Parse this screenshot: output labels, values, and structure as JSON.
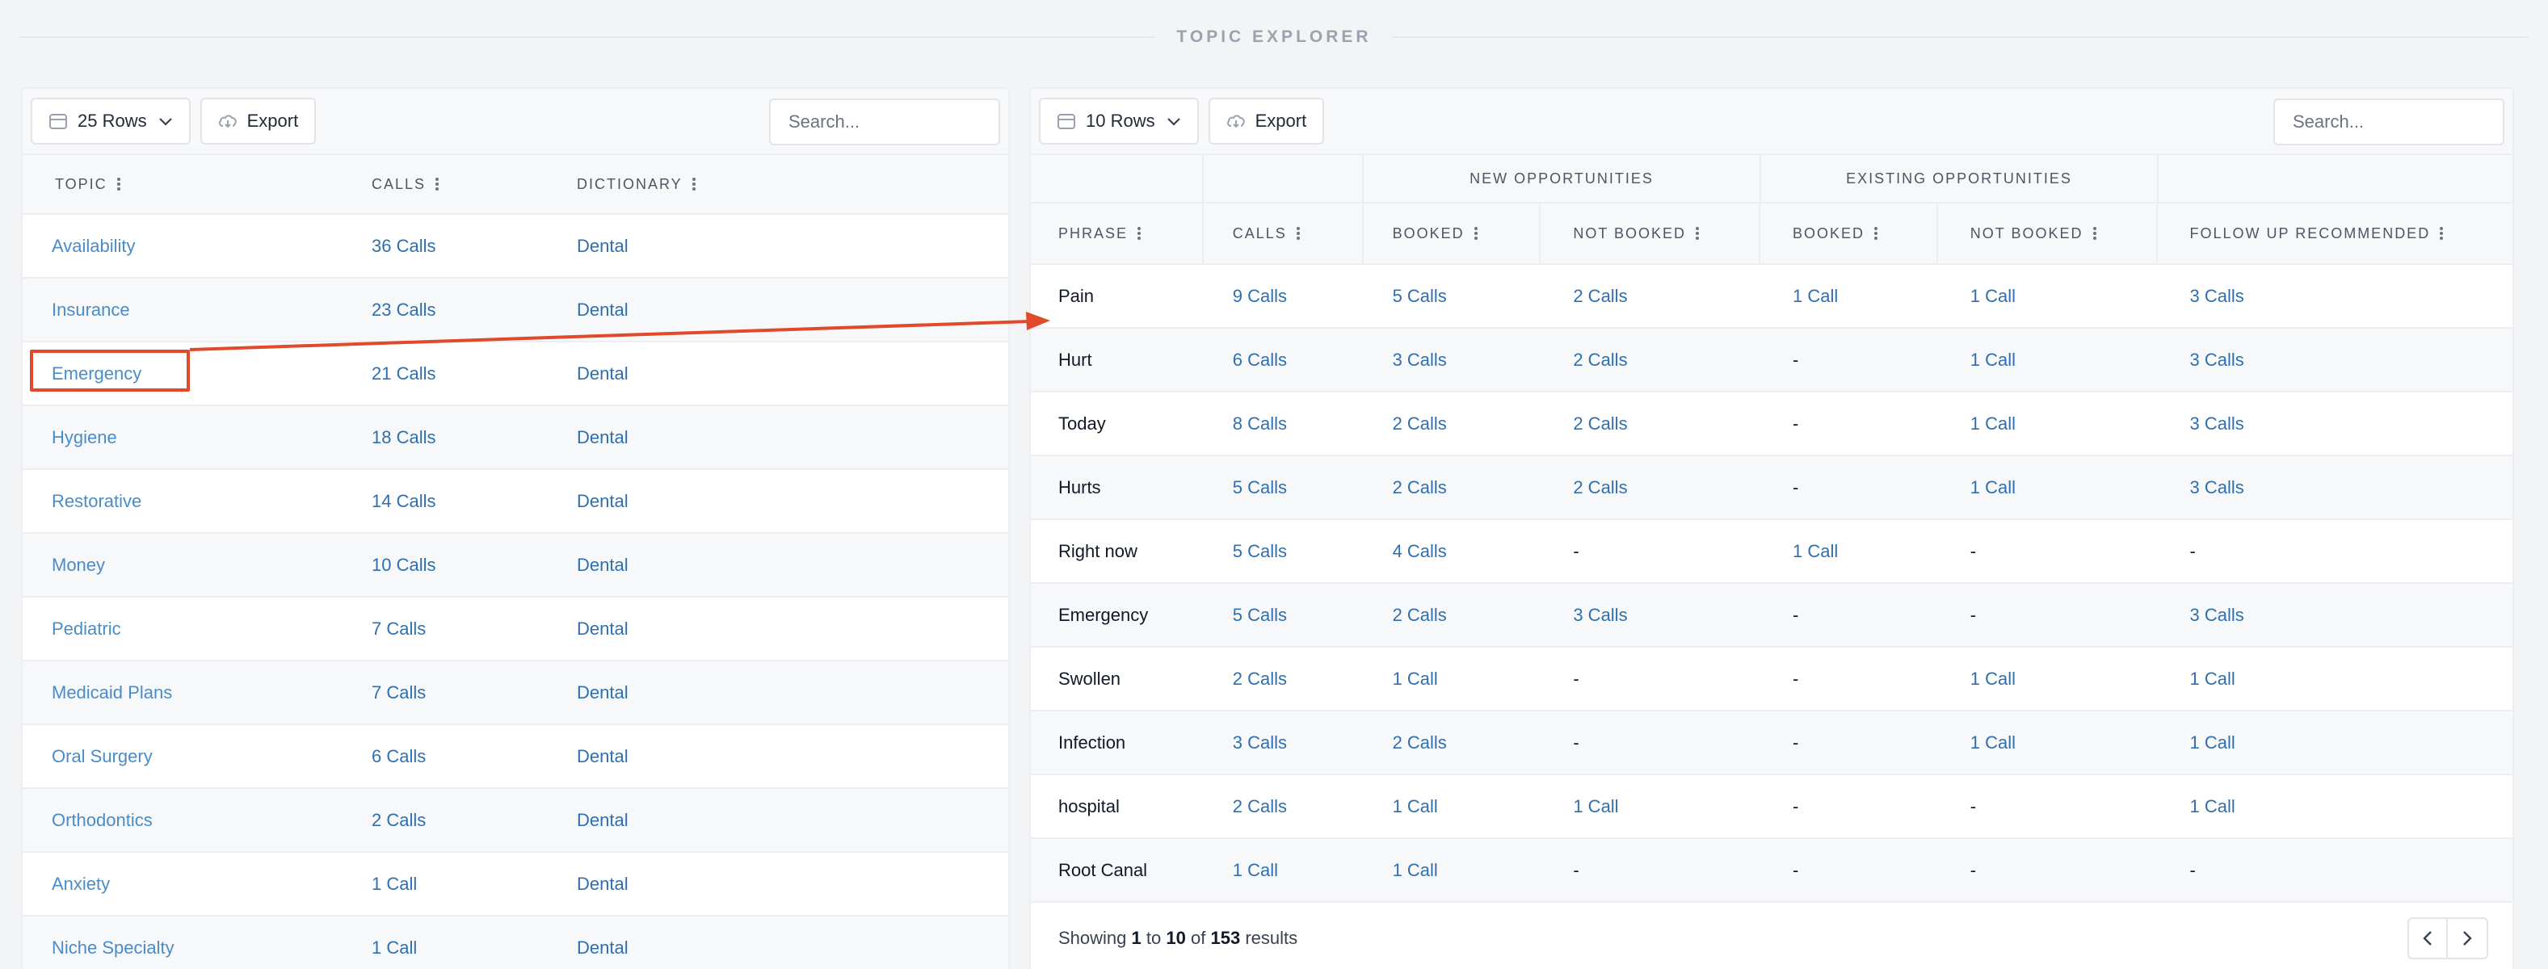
{
  "section_title": "TOPIC EXPLORER",
  "left": {
    "rows_label": "25 Rows",
    "export_label": "Export",
    "search_placeholder": "Search...",
    "columns": [
      "TOPIC",
      "CALLS",
      "DICTIONARY"
    ],
    "rows": [
      {
        "topic": "Availability",
        "calls": "36 Calls",
        "dictionary": "Dental"
      },
      {
        "topic": "Insurance",
        "calls": "23 Calls",
        "dictionary": "Dental"
      },
      {
        "topic": "Emergency",
        "calls": "21 Calls",
        "dictionary": "Dental"
      },
      {
        "topic": "Hygiene",
        "calls": "18 Calls",
        "dictionary": "Dental"
      },
      {
        "topic": "Restorative",
        "calls": "14 Calls",
        "dictionary": "Dental"
      },
      {
        "topic": "Money",
        "calls": "10 Calls",
        "dictionary": "Dental"
      },
      {
        "topic": "Pediatric",
        "calls": "7 Calls",
        "dictionary": "Dental"
      },
      {
        "topic": "Medicaid Plans",
        "calls": "7 Calls",
        "dictionary": "Dental"
      },
      {
        "topic": "Oral Surgery",
        "calls": "6 Calls",
        "dictionary": "Dental"
      },
      {
        "topic": "Orthodontics",
        "calls": "2 Calls",
        "dictionary": "Dental"
      },
      {
        "topic": "Anxiety",
        "calls": "1 Call",
        "dictionary": "Dental"
      },
      {
        "topic": "Niche Specialty",
        "calls": "1 Call",
        "dictionary": "Dental"
      }
    ]
  },
  "right": {
    "rows_label": "10 Rows",
    "export_label": "Export",
    "search_placeholder": "Search...",
    "groups": [
      "NEW OPPORTUNITIES",
      "EXISTING OPPORTUNITIES"
    ],
    "columns": [
      "PHRASE",
      "CALLS",
      "BOOKED",
      "NOT BOOKED",
      "BOOKED",
      "NOT BOOKED",
      "FOLLOW UP RECOMMENDED"
    ],
    "rows": [
      [
        "Pain",
        "9 Calls",
        "5 Calls",
        "2 Calls",
        "1 Call",
        "1 Call",
        "3 Calls"
      ],
      [
        "Hurt",
        "6 Calls",
        "3 Calls",
        "2 Calls",
        "-",
        "1 Call",
        "3 Calls"
      ],
      [
        "Today",
        "8 Calls",
        "2 Calls",
        "2 Calls",
        "-",
        "1 Call",
        "3 Calls"
      ],
      [
        "Hurts",
        "5 Calls",
        "2 Calls",
        "2 Calls",
        "-",
        "1 Call",
        "3 Calls"
      ],
      [
        "Right now",
        "5 Calls",
        "4 Calls",
        "-",
        "1 Call",
        "-",
        "-"
      ],
      [
        "Emergency",
        "5 Calls",
        "2 Calls",
        "3 Calls",
        "-",
        "-",
        "3 Calls"
      ],
      [
        "Swollen",
        "2 Calls",
        "1 Call",
        "-",
        "-",
        "1 Call",
        "1 Call"
      ],
      [
        "Infection",
        "3 Calls",
        "2 Calls",
        "-",
        "-",
        "1 Call",
        "1 Call"
      ],
      [
        "hospital",
        "2 Calls",
        "1 Call",
        "1 Call",
        "-",
        "-",
        "1 Call"
      ],
      [
        "Root Canal",
        "1 Call",
        "1 Call",
        "-",
        "-",
        "-",
        "-"
      ]
    ],
    "footer": {
      "prefix": "Showing",
      "from": "1",
      "to_word": "to",
      "to": "10",
      "of_word": "of",
      "total": "153",
      "suffix": "results"
    }
  },
  "colors": {
    "annotation": "#e04a2a",
    "link": "#2f6fb0"
  }
}
